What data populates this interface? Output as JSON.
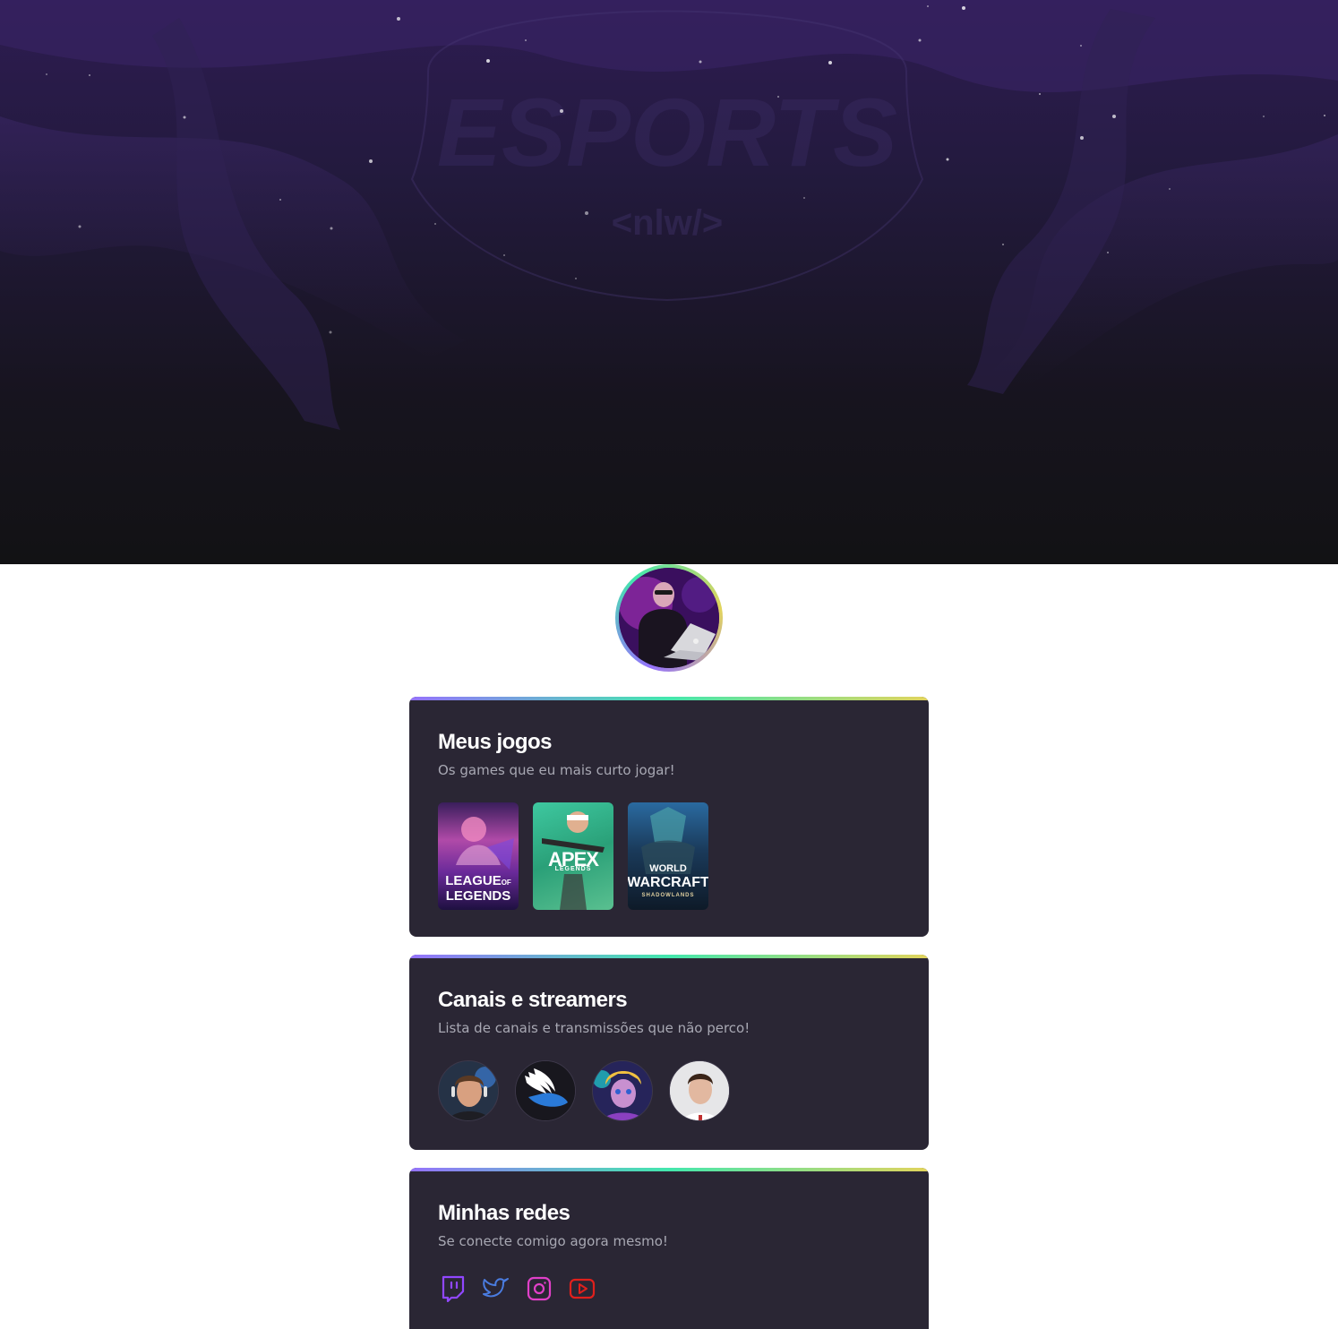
{
  "hero": {
    "logo_text": "ESPORTS",
    "logo_subtext": "<nlw/>"
  },
  "profile": {
    "avatar_icon": "gamer-avatar"
  },
  "games_card": {
    "title": "Meus jogos",
    "subtitle": "Os games que eu mais curto jogar!",
    "games": [
      {
        "name": "LEAGUE OF LEGENDS",
        "line1": "LEAGUE",
        "line2": "LEGENDS",
        "of": "OF"
      },
      {
        "name": "APEX LEGENDS",
        "line1": "APEX",
        "line2": "LEGENDS"
      },
      {
        "name": "WORLD OF WARCRAFT SHADOWLANDS",
        "line1": "WORLD",
        "line2": "WARCRAFT",
        "line3": "SHADOWLANDS"
      }
    ]
  },
  "streamers_card": {
    "title": "Canais e streamers",
    "subtitle": "Lista de canais e transmissões que não perco!",
    "streamers": [
      "streamer-1",
      "streamer-2",
      "streamer-3",
      "streamer-4"
    ]
  },
  "socials_card": {
    "title": "Minhas redes",
    "subtitle": "Se conecte comigo agora mesmo!",
    "networks": [
      {
        "icon": "twitch-icon",
        "color": "#9147ff"
      },
      {
        "icon": "twitter-icon",
        "color": "#4a7ce0"
      },
      {
        "icon": "instagram-icon",
        "color": "#e040c8"
      },
      {
        "icon": "youtube-icon",
        "color": "#e0201c"
      }
    ]
  }
}
